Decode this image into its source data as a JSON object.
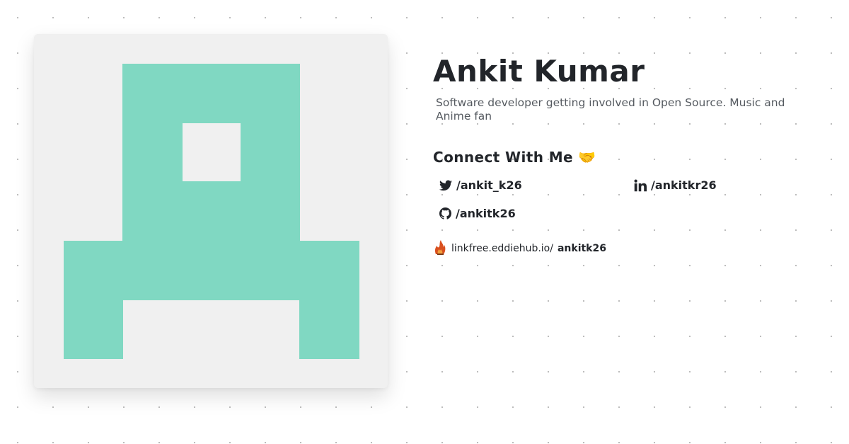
{
  "profile": {
    "name": "Ankit Kumar",
    "bio": "Software developer getting involved in Open Source. Music and Anime fan",
    "avatar_colors": {
      "background": "#f0f0f0",
      "shape": "#80d8c2"
    }
  },
  "connect": {
    "heading": "Connect With Me 🤝",
    "links": [
      {
        "icon": "twitter-icon",
        "label": "/ankit_k26"
      },
      {
        "icon": "linkedin-icon",
        "label": "/ankitkr26"
      },
      {
        "icon": "github-icon",
        "label": "/ankitk26"
      }
    ]
  },
  "linkfree": {
    "icon": "linkfree-logo-icon",
    "domain": "linkfree.eddiehub.io/",
    "username": "ankitk26"
  }
}
